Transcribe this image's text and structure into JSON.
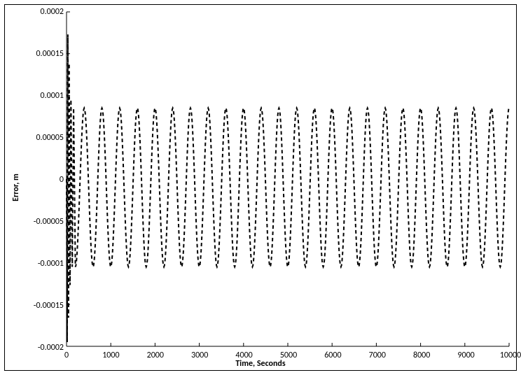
{
  "chart_data": {
    "type": "line",
    "title": "",
    "xlabel": "Time, Seconds",
    "ylabel": "Error, m",
    "xlim": [
      0,
      10000
    ],
    "ylim": [
      -0.0002,
      0.0002
    ],
    "xticks": [
      0,
      1000,
      2000,
      3000,
      4000,
      5000,
      6000,
      7000,
      8000,
      9000,
      10000
    ],
    "yticks": [
      -0.0002,
      -0.00015,
      -0.0001,
      -5e-05,
      0,
      5e-05,
      0.0001,
      0.00015,
      0.0002
    ],
    "xtick_labels": [
      "0",
      "1000",
      "2000",
      "3000",
      "4000",
      "5000",
      "6000",
      "7000",
      "8000",
      "9000",
      "10000"
    ],
    "ytick_labels": [
      "-0.0002",
      "-0.00015",
      "-0.0001",
      "-0.00005",
      "0",
      "0.00005",
      "0.0001",
      "0.00015",
      "0.0002"
    ],
    "grid": false,
    "legend": false,
    "series": [
      {
        "name": "Error",
        "style": "dashed",
        "color": "#000000",
        "initial_transient": {
          "x_range": [
            0,
            200
          ],
          "peak_positive": 0.000173,
          "peak_negative": -0.000195
        },
        "steady_state_oscillation": {
          "x_range": [
            200,
            10000
          ],
          "amplitude_positive": 8.5e-05,
          "amplitude_negative": -0.000105,
          "period": 400,
          "cycles_visible": 25
        }
      }
    ]
  }
}
